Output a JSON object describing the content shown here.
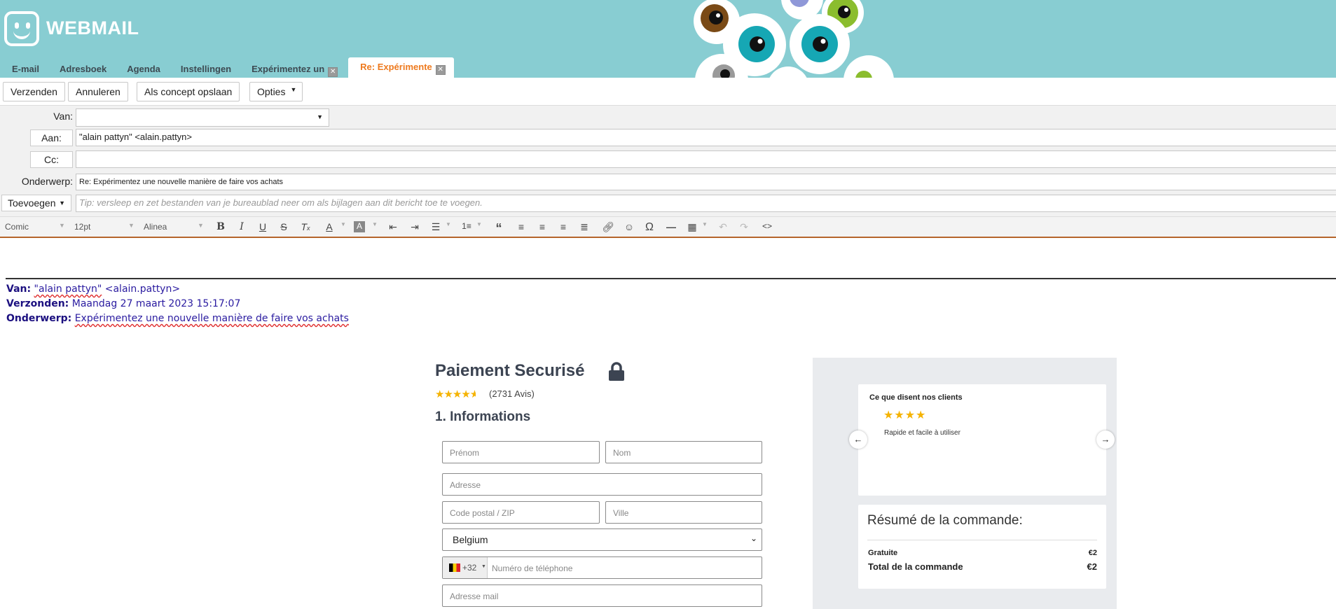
{
  "app": {
    "logo_text": "WEBMAIL"
  },
  "tabs": [
    {
      "label": "E-mail"
    },
    {
      "label": "Adresboek"
    },
    {
      "label": "Agenda"
    },
    {
      "label": "Instellingen"
    },
    {
      "label": "Expérimentez un",
      "closable": true
    },
    {
      "label": "Re: Expérimente",
      "closable": true,
      "active": true
    }
  ],
  "toolbar": {
    "send_label": "Verzenden",
    "cancel_label": "Annuleren",
    "draft_label": "Als concept opslaan",
    "options_label": "Opties"
  },
  "compose": {
    "from_label": "Van:",
    "from_value": "",
    "to_label": "Aan:",
    "to_value": "\"alain pattyn\" <alain.pattyn>",
    "cc_label": "Cc:",
    "cc_value": "",
    "subject_label": "Onderwerp:",
    "subject_value": "Re: Expérimentez une nouvelle manière de faire vos achats",
    "attach_label": "Toevoegen",
    "attach_hint": "Tip: versleep en zet bestanden van je bureaublad neer om als bijlagen aan dit bericht toe te voegen."
  },
  "editor_toolbar": {
    "font": "Comic",
    "size": "12pt",
    "block": "Alinea"
  },
  "quoted": {
    "from_label": "Van:",
    "from_name": "\"alain pattyn\"",
    "from_addr": "<alain.pattyn>",
    "sent_label": "Verzonden:",
    "sent_value": "Maandag 27 maart 2023 15:17:07",
    "subject_label": "Onderwerp:",
    "subject_value": "Expérimentez une nouvelle manière de faire vos achats"
  },
  "payment": {
    "title": "Paiement Securisé",
    "rating": 4.5,
    "reviews": "(2731 Avis)",
    "section": "1. Informations",
    "fields": {
      "first_name": "Prénom",
      "last_name": "Nom",
      "address": "Adresse",
      "zip": "Code postal / ZIP",
      "city": "Ville",
      "country": "Belgium",
      "phone_code": "+32",
      "phone": "Numéro de téléphone",
      "email": "Adresse mail"
    }
  },
  "testimonials": {
    "title": "Ce que disent nos clients",
    "stars": 4,
    "quote": "Rapide et facile à utiliser"
  },
  "summary": {
    "title": "Résumé de la commande:",
    "rows": [
      {
        "label": "Gratuite",
        "value": "€2"
      },
      {
        "label": "Total de la commande",
        "value": "€2"
      }
    ]
  },
  "colors": {
    "header_bg": "#88cdd2",
    "active_tab": "#ee7a1e",
    "quote_text": "#2a1ba0"
  }
}
